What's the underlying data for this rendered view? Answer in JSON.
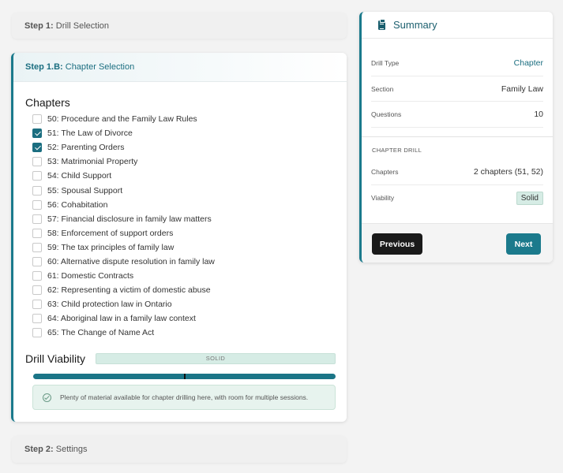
{
  "steps": {
    "step1": {
      "prefix": "Step 1:",
      "label": "Drill Selection"
    },
    "step1b": {
      "prefix": "Step 1.B:",
      "label": "Chapter Selection"
    },
    "step2": {
      "prefix": "Step 2:",
      "label": "Settings"
    }
  },
  "chapters": {
    "title": "Chapters",
    "items": [
      {
        "label": "50: Procedure and the Family Law Rules",
        "checked": false
      },
      {
        "label": "51: The Law of Divorce",
        "checked": true
      },
      {
        "label": "52: Parenting Orders",
        "checked": true
      },
      {
        "label": "53: Matrimonial Property",
        "checked": false
      },
      {
        "label": "54: Child Support",
        "checked": false
      },
      {
        "label": "55: Spousal Support",
        "checked": false
      },
      {
        "label": "56: Cohabitation",
        "checked": false
      },
      {
        "label": "57: Financial disclosure in family law matters",
        "checked": false
      },
      {
        "label": "58: Enforcement of support orders",
        "checked": false
      },
      {
        "label": "59: The tax principles of family law",
        "checked": false
      },
      {
        "label": "60: Alternative dispute resolution in family law",
        "checked": false
      },
      {
        "label": "61: Domestic Contracts",
        "checked": false
      },
      {
        "label": "62: Representing a victim of domestic abuse",
        "checked": false
      },
      {
        "label": "63: Child protection law in Ontario",
        "checked": false
      },
      {
        "label": "64: Aboriginal law in a family law context",
        "checked": false
      },
      {
        "label": "65: The Change of Name Act",
        "checked": false
      }
    ]
  },
  "viability": {
    "title": "Drill Viability",
    "badge": "SOLID",
    "level": 0.5,
    "message": "Plenty of material available for chapter drilling here, with room for multiple sessions."
  },
  "summary": {
    "title": "Summary",
    "drill_type_label": "Drill Type",
    "drill_type_value": "Chapter",
    "section_label": "Section",
    "section_value": "Family Law",
    "questions_label": "Questions",
    "questions_value": "10",
    "caption": "CHAPTER DRILL",
    "chapters_label": "Chapters",
    "chapters_value": "2 chapters (51, 52)",
    "viability_label": "Viability",
    "viability_value": "Solid"
  },
  "buttons": {
    "previous": "Previous",
    "next": "Next"
  },
  "colors": {
    "accent": "#1b7a8c",
    "solid_green": "#d6ece5"
  }
}
